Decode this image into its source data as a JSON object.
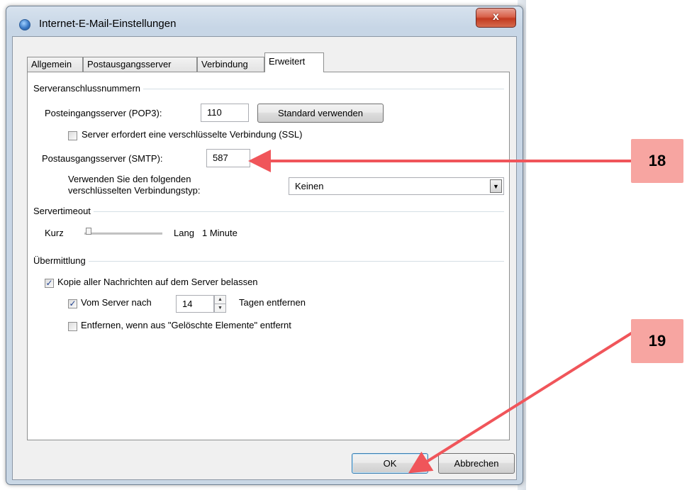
{
  "window": {
    "title": "Internet-E-Mail-Einstellungen",
    "close_glyph": "x"
  },
  "tabs": [
    {
      "label": "Allgemein",
      "active": false
    },
    {
      "label": "Postausgangsserver",
      "active": false
    },
    {
      "label": "Verbindung",
      "active": false
    },
    {
      "label": "Erweitert",
      "active": true
    }
  ],
  "serverports": {
    "group_label": "Serveranschlussnummern",
    "pop3_label": "Posteingangsserver (POP3):",
    "pop3_value": "110",
    "default_button": "Standard verwenden",
    "ssl_label": "Server erfordert eine verschlüsselte Verbindung (SSL)",
    "ssl_checked": false,
    "smtp_label": "Postausgangsserver (SMTP):",
    "smtp_value": "587",
    "encryption_label_1": "Verwenden Sie den folgenden",
    "encryption_label_2": "verschlüsselten Verbindungstyp:",
    "encryption_value": "Keinen"
  },
  "timeout": {
    "group_label": "Servertimeout",
    "short_label": "Kurz",
    "long_label": "Lang",
    "value_label": "1 Minute",
    "level": 0.0
  },
  "delivery": {
    "group_label": "Übermittlung",
    "keep_copy_label": "Kopie aller Nachrichten auf dem Server belassen",
    "keep_copy_checked": true,
    "remove_after_label": "Vom Server nach",
    "remove_after_checked": true,
    "days_value": "14",
    "days_suffix": "Tagen entfernen",
    "remove_deleted_label": "Entfernen, wenn aus \"Gelöschte Elemente\" entfernt",
    "remove_deleted_checked": false
  },
  "buttons": {
    "ok": "OK",
    "cancel": "Abbrechen"
  },
  "callouts": {
    "step_18": "18",
    "step_19": "19",
    "color": "#f7a5a1",
    "arrow_color": "#f0555a"
  }
}
